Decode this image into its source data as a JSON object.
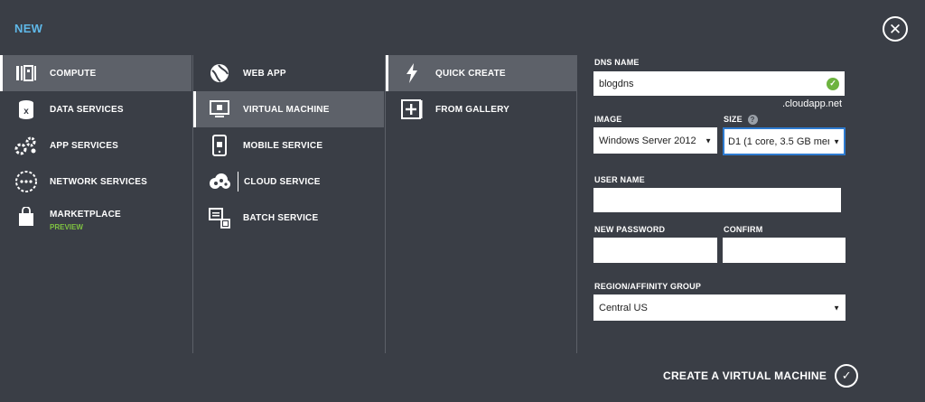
{
  "header": {
    "title": "NEW",
    "close_symbol": "✕"
  },
  "categories": [
    {
      "label": "COMPUTE",
      "icon": "compute-icon",
      "selected": true
    },
    {
      "label": "DATA SERVICES",
      "icon": "data-services-icon",
      "selected": false
    },
    {
      "label": "APP SERVICES",
      "icon": "gears-icon",
      "selected": false
    },
    {
      "label": "NETWORK SERVICES",
      "icon": "network-icon",
      "selected": false
    },
    {
      "label": "MARKETPLACE",
      "sublabel": "PREVIEW",
      "icon": "shopping-bag-icon",
      "selected": false
    }
  ],
  "services": [
    {
      "label": "WEB APP",
      "icon": "globe-icon",
      "selected": false
    },
    {
      "label": "VIRTUAL MACHINE",
      "icon": "virtual-machine-icon",
      "selected": true
    },
    {
      "label": "MOBILE SERVICE",
      "icon": "mobile-icon",
      "selected": false
    },
    {
      "label": "CLOUD SERVICE",
      "icon": "cloud-icon",
      "selected": false
    },
    {
      "label": "BATCH SERVICE",
      "icon": "batch-icon",
      "selected": false
    }
  ],
  "methods": [
    {
      "label": "QUICK CREATE",
      "icon": "lightning-icon",
      "selected": true
    },
    {
      "label": "FROM GALLERY",
      "icon": "gallery-plus-icon",
      "selected": false
    }
  ],
  "form": {
    "dns_label": "DNS NAME",
    "dns_value": "blogdns",
    "dns_suffix": ".cloudapp.net",
    "image_label": "IMAGE",
    "image_value": "Windows Server 2012",
    "size_label": "SIZE",
    "size_help": "?",
    "size_value": "D1 (1 core, 3.5 GB mer",
    "username_label": "USER NAME",
    "username_value": "",
    "password_label": "NEW PASSWORD",
    "password_value": "",
    "confirm_label": "CONFIRM",
    "confirm_value": "",
    "region_label": "REGION/AFFINITY GROUP",
    "region_value": "Central US",
    "dropdown_arrow": "▼",
    "valid_mark": "✓"
  },
  "footer": {
    "create_label": "CREATE A VIRTUAL MACHINE",
    "create_symbol": "✓"
  },
  "colors": {
    "background": "#3a3e46",
    "selected": "#5d6169",
    "accent_title": "#5fb8e8",
    "preview_green": "#7fc241",
    "valid_green": "#6db33f"
  }
}
